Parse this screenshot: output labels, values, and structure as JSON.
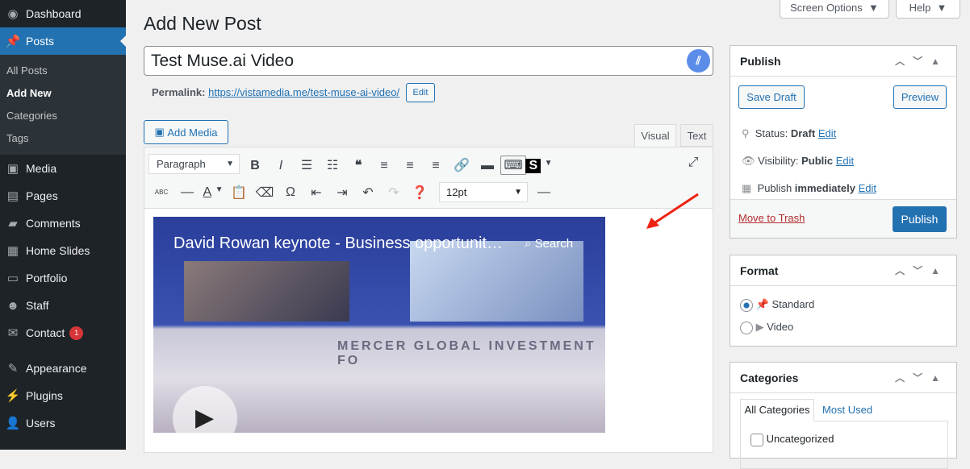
{
  "sidebar": {
    "items": [
      {
        "label": "Dashboard",
        "icon": "dashboard-icon"
      },
      {
        "label": "Posts",
        "icon": "pin-icon"
      }
    ],
    "posts_sub": [
      "All Posts",
      "Add New",
      "Categories",
      "Tags"
    ],
    "items2": [
      {
        "label": "Media"
      },
      {
        "label": "Pages"
      },
      {
        "label": "Comments"
      },
      {
        "label": "Home Slides"
      },
      {
        "label": "Portfolio"
      },
      {
        "label": "Staff"
      },
      {
        "label": "Contact",
        "badge": "1"
      },
      {
        "label": "Appearance"
      },
      {
        "label": "Plugins"
      },
      {
        "label": "Users"
      }
    ]
  },
  "header": {
    "screen_options": "Screen Options",
    "help": "Help",
    "title": "Add New Post"
  },
  "post": {
    "title": "Test Muse.ai Video",
    "permalink_label": "Permalink:",
    "permalink_url": "https://vistamedia.me/test-muse-ai-video/",
    "edit": "Edit"
  },
  "editor": {
    "add_media": "Add Media",
    "tab_visual": "Visual",
    "tab_text": "Text",
    "format": "Paragraph",
    "font_size": "12pt"
  },
  "video": {
    "title": "David Rowan keynote - Business opportunit…",
    "search": "Search",
    "banner": "MERCER GLOBAL INVESTMENT FO"
  },
  "publish": {
    "title": "Publish",
    "save_draft": "Save Draft",
    "preview": "Preview",
    "status_label": "Status:",
    "status": "Draft",
    "visibility_label": "Visibility:",
    "visibility": "Public",
    "publish_label": "Publish",
    "publish_when": "immediately",
    "edit": "Edit",
    "trash": "Move to Trash",
    "publish_btn": "Publish"
  },
  "format": {
    "title": "Format",
    "options": [
      "Standard",
      "Video"
    ],
    "selected": "Standard"
  },
  "categories": {
    "title": "Categories",
    "tabs": [
      "All Categories",
      "Most Used"
    ],
    "items": [
      "Uncategorized"
    ]
  }
}
